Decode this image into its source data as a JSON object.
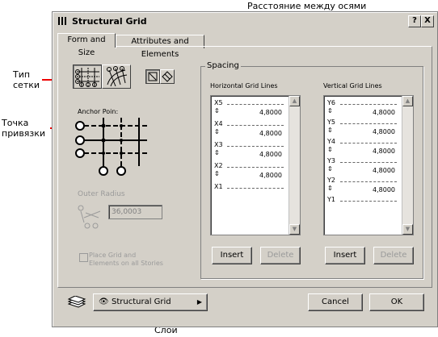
{
  "annotations": {
    "grid_type": "Тип\nсетки",
    "anchor_point": "Точка\nпривязки",
    "spacing": "Расстояние между осями",
    "layer": "Слой"
  },
  "dialog": {
    "title": "Structural Grid",
    "help_btn": "?",
    "close_btn": "X",
    "tabs": [
      "Form and Size",
      "Attributes and Elements"
    ],
    "anchor_label": "Anchor Poin:",
    "outer_radius_label": "Outer Radius",
    "outer_radius_value": "36,0003",
    "place_grid_label_line1": "Place Grid and",
    "place_grid_label_line2": "Elements on all Stories",
    "spacing_group": "Spacing",
    "horizontal_label": "Horizontal Grid Lines",
    "vertical_label": "Vertical Grid Lines",
    "horizontal_lines": [
      "X5",
      "X4",
      "X3",
      "X2",
      "X1"
    ],
    "vertical_lines": [
      "Y6",
      "Y5",
      "Y4",
      "Y3",
      "Y2",
      "Y1"
    ],
    "spacing_value": "4,8000",
    "insert_label": "Insert",
    "delete_label": "Delete",
    "layer_value": "Structural Grid",
    "cancel_label": "Cancel",
    "ok_label": "OK"
  },
  "colors": {
    "annotation_arrow": "#e00000",
    "dialog_bg": "#d4d0c8"
  }
}
